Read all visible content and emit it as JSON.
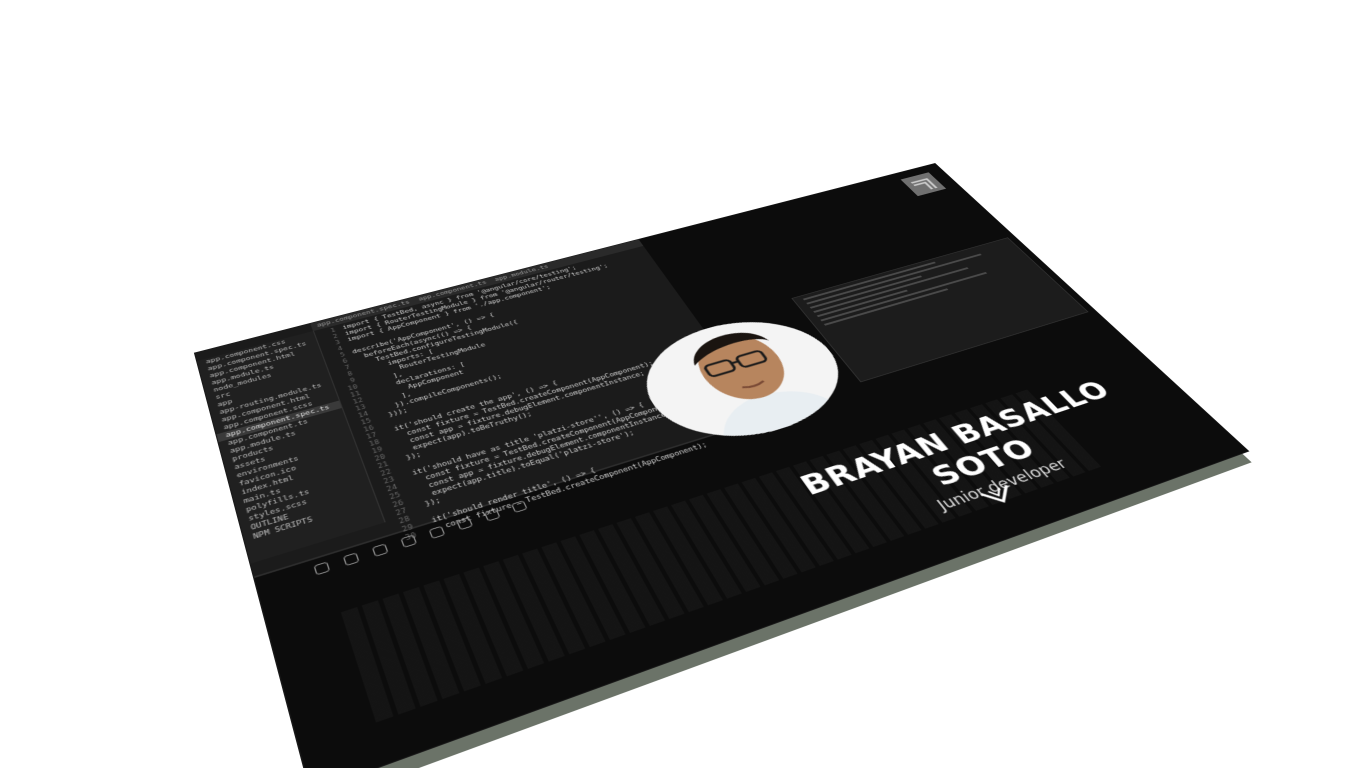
{
  "hero": {
    "name": "BRAYAN BASALLO SOTO",
    "role": "Junior developer"
  },
  "icons": {
    "brand": "brand-logo-icon",
    "scroll": "chevron-down-icon"
  },
  "colors": {
    "background": "#0c0c0c",
    "slab_edge": "#6b7368",
    "text": "#ffffff"
  },
  "editor": {
    "tabs": [
      "app.component.spec.ts",
      "app.component.ts",
      "app.module.ts"
    ],
    "files": [
      "app.component.css",
      "app.component.spec.ts",
      "app.component.html",
      "app.module.ts",
      "node_modules",
      "src",
      "app",
      "app-routing.module.ts",
      "app.component.html",
      "app.component.scss",
      "app.component.spec.ts",
      "app.component.ts",
      "app.module.ts",
      "products",
      "assets",
      "environments",
      "favicon.ico",
      "index.html",
      "main.ts",
      "polyfills.ts",
      "styles.scss",
      "OUTLINE",
      "NPM SCRIPTS"
    ],
    "code": [
      "import { TestBed, async } from '@angular/core/testing';",
      "import { RouterTestingModule } from '@angular/router/testing';",
      "import { AppComponent } from './app.component';",
      "",
      "describe('AppComponent', () => {",
      "  beforeEach(async(() => {",
      "    TestBed.configureTestingModule({",
      "      imports: [",
      "        RouterTestingModule",
      "      ],",
      "      declarations: [",
      "        AppComponent",
      "      ],",
      "    }).compileComponents();",
      "  }));",
      "",
      "  it('should create the app', () => {",
      "    const fixture = TestBed.createComponent(AppComponent);",
      "    const app = fixture.debugElement.componentInstance;",
      "    expect(app).toBeTruthy();",
      "  });",
      "",
      "  it('should have as title 'platzi-store'', () => {",
      "    const fixture = TestBed.createComponent(AppComponent);",
      "    const app = fixture.debugElement.componentInstance;",
      "    expect(app.title).toEqual('platzi-store');",
      "  });",
      "",
      "  it('should render title', () => {",
      "    const fixture = TestBed.createComponent(AppComponent);"
    ]
  }
}
